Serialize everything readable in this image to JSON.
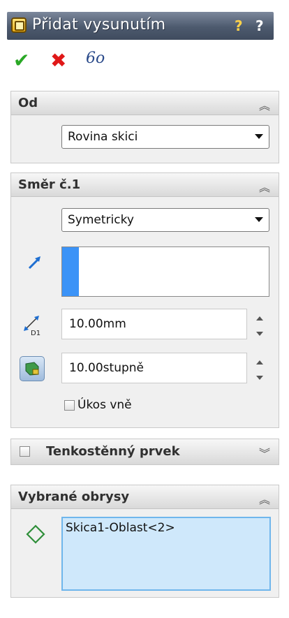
{
  "title": "Přidat vysunutím",
  "toolbar": {
    "help_icon": "question-icon",
    "ok_icon": "checkmark-icon",
    "cancel_icon": "x-icon",
    "preview_icon": "glasses-icon"
  },
  "from_group": {
    "title": "Od",
    "selected": "Rovina skici"
  },
  "direction_group": {
    "title": "Směr č.1",
    "end_condition": "Symetricky",
    "depth": "10.00mm",
    "draft_angle": "10.00stupně",
    "draft_outward_label": "Úkos vně",
    "draft_outward_checked": false
  },
  "thin_group": {
    "title": "Tenkostěnný prvek",
    "checked": false
  },
  "contours_group": {
    "title": "Vybrané obrysy",
    "items": [
      "Skica1-Oblast<2>"
    ]
  },
  "colors": {
    "accent": "#3b93f7",
    "ok": "#2aa826",
    "cancel": "#e01818"
  }
}
